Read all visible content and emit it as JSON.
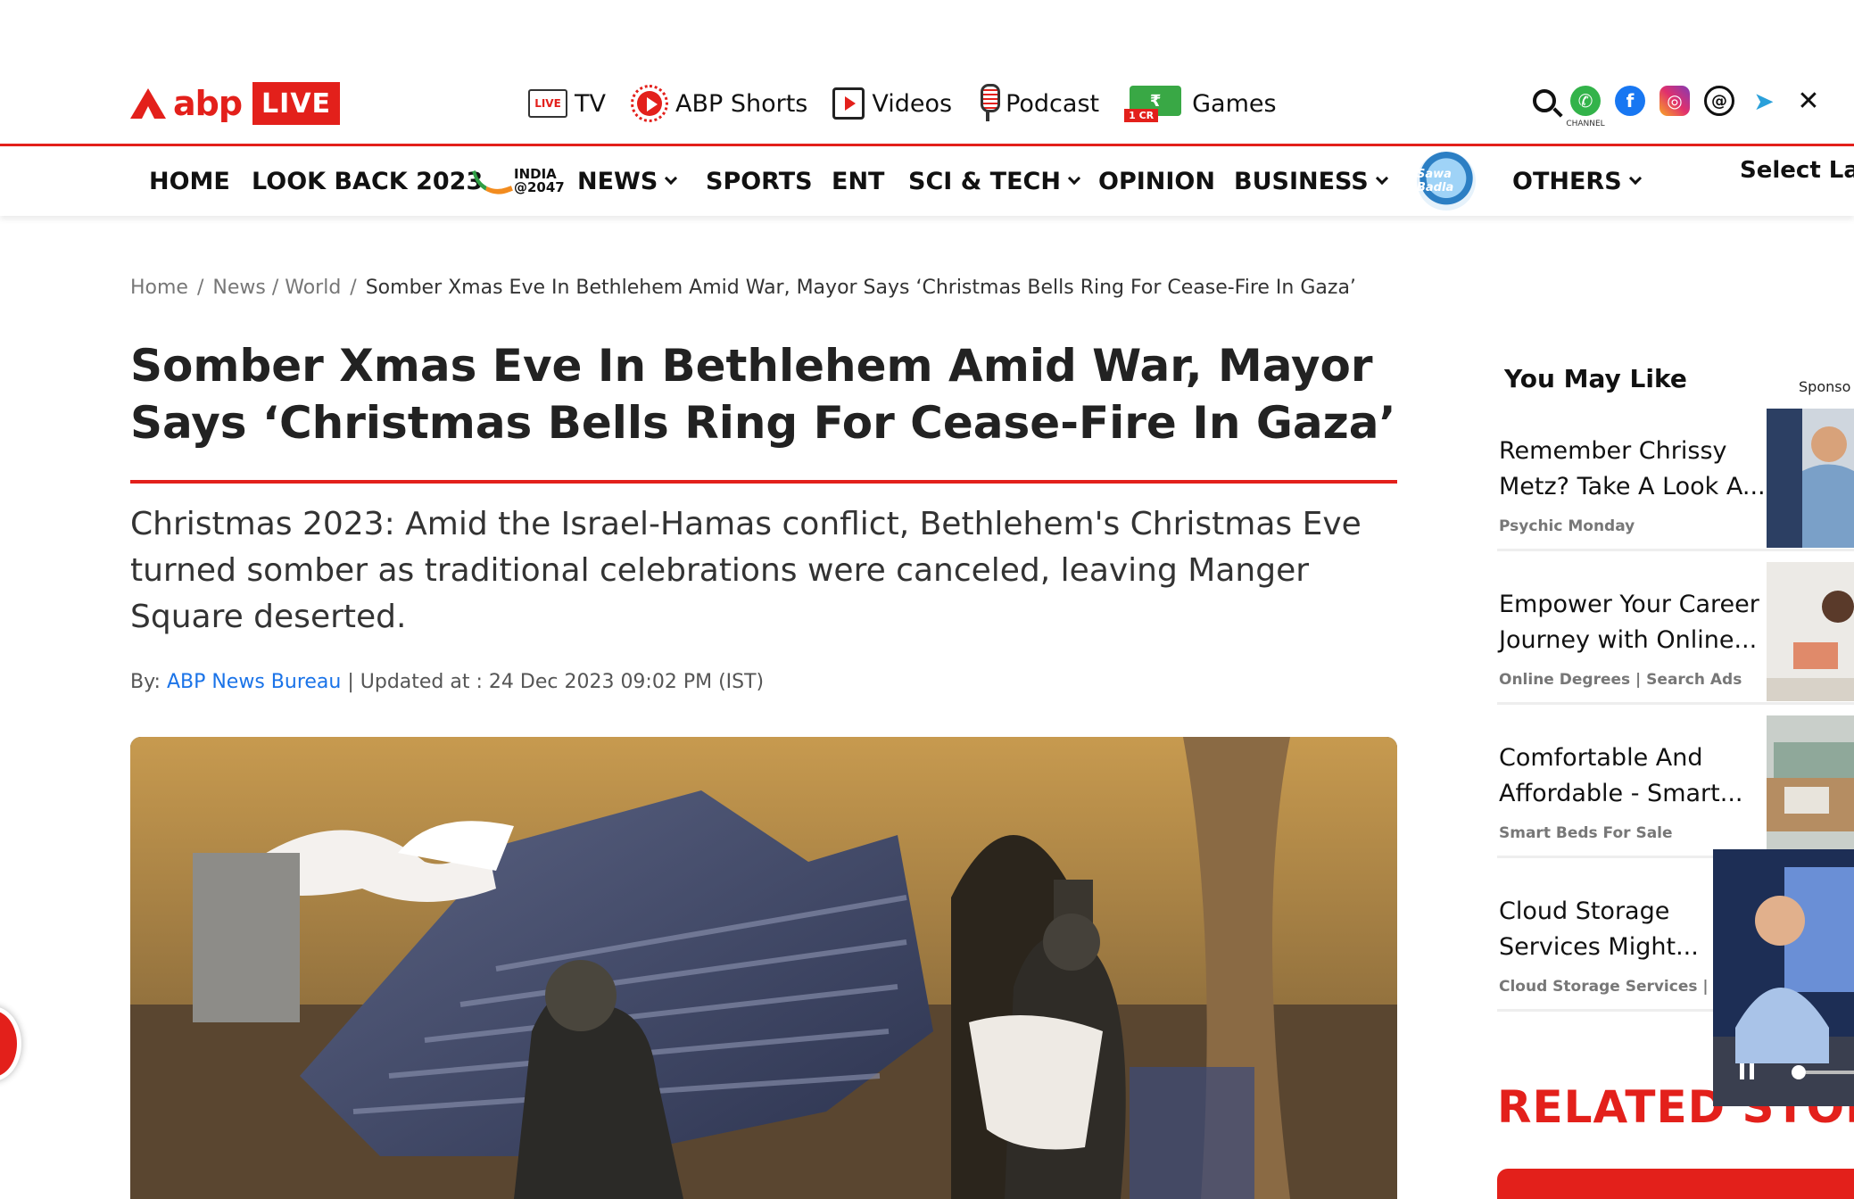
{
  "brand": {
    "name": "abp",
    "badge": "LIVE"
  },
  "top_nav": [
    {
      "label": "TV",
      "icon": "live-tv-icon",
      "icon_text": "LIVE"
    },
    {
      "label": "ABP Shorts",
      "icon": "shorts-play-icon"
    },
    {
      "label": "Videos",
      "icon": "video-play-icon"
    },
    {
      "label": "Podcast",
      "icon": "microphone-icon"
    },
    {
      "label": "Games",
      "icon": "money-games-icon",
      "icon_text": "₹",
      "icon_badge": "1 CR"
    }
  ],
  "social": {
    "whatsapp_caption": "CHANNEL",
    "icons": [
      "search-icon",
      "whatsapp-icon",
      "facebook-icon",
      "instagram-icon",
      "threads-icon",
      "telegram-icon",
      "x-icon"
    ]
  },
  "main_nav": {
    "home": "HOME",
    "look_back": "LOOK BACK 2023",
    "india_line1": "INDIA",
    "india_line2": "@2047",
    "news": "NEWS",
    "sports": "SPORTS",
    "ent": "ENT",
    "scitech": "SCI & TECH",
    "opinion": "OPINION",
    "business": "BUSINESS",
    "sawa": "Sawa Badla",
    "others": "OTHERS",
    "select_language": "Select Lan"
  },
  "breadcrumb": {
    "home": "Home",
    "sep": "/",
    "section": "News / World",
    "current": "Somber Xmas Eve In Bethlehem Amid War, Mayor Says ‘Christmas Bells Ring For Cease-Fire In Gaza’"
  },
  "article": {
    "title": "Somber Xmas Eve In Bethlehem Amid War, Mayor Says ‘Christmas Bells Ring For Cease-Fire In Gaza’",
    "summary": "Christmas 2023: Amid the Israel-Hamas conflict, Bethlehem's Christmas Eve turned somber as traditional celebrations were canceled, leaving Manger Square deserted.",
    "by_label": "By:",
    "author": "ABP News Bureau",
    "updated_label": "| Updated at :",
    "updated_value": "24 Dec 2023 09:02 PM (IST)"
  },
  "sidebar": {
    "heading": "You May Like",
    "sponsored": "Sponso",
    "cards": [
      {
        "title": "Remember Chrissy Metz? Take A Look A...",
        "source": "Psychic Monday"
      },
      {
        "title": "Empower Your Career Journey with Online...",
        "source": "Online Degrees | Search Ads"
      },
      {
        "title": "Comfortable And Affordable - Smart...",
        "source": "Smart Beds For Sale"
      },
      {
        "title": "Cloud Storage Services Might...",
        "source": "Cloud Storage Services | Sea"
      }
    ],
    "related_heading": "RELATED STORI"
  },
  "player": {
    "close_label": "X"
  },
  "colors": {
    "brand_red": "#e3201b",
    "link_blue": "#1a73e8"
  }
}
